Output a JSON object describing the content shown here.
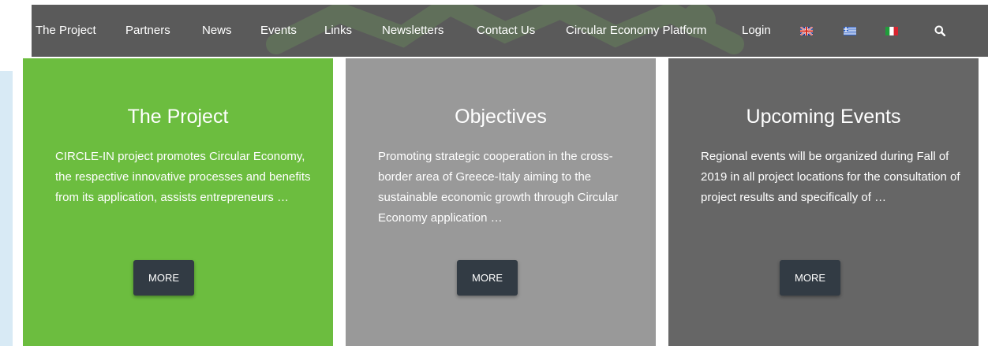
{
  "nav": {
    "links": [
      "The Project",
      "Partners",
      "News",
      "Events",
      "Links",
      "Newsletters",
      "Contact Us",
      "Circular Economy Platform",
      "Login"
    ],
    "flags": [
      "en-flag-icon",
      "gr-flag-icon",
      "it-flag-icon"
    ],
    "search_icon": "search-icon"
  },
  "cards": [
    {
      "title": "The Project",
      "text": "CIRCLE-IN project promotes Circular Economy, the respective innovative processes and benefits from its application, assists entrepreneurs …",
      "button": "MORE",
      "color": "#6cbd3f"
    },
    {
      "title": "Objectives",
      "text": "Promoting strategic cooperation in the cross-border area of Greece-Italy aiming to the sustainable economic growth through Circular Economy application …",
      "button": "MORE",
      "color": "#999999"
    },
    {
      "title": "Upcoming Events",
      "text": "Regional events will be organized during Fall of 2019 in all project locations for the consultation of project results and specifically of …",
      "button": "MORE",
      "color": "#666666"
    }
  ],
  "colors": {
    "navbar": "#5a5a5a",
    "button": "#323b44"
  }
}
